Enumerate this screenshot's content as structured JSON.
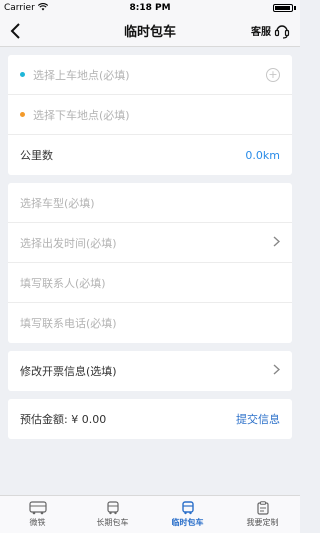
{
  "status": {
    "carrier": "Carrier",
    "time": "8:18 PM"
  },
  "nav": {
    "title": "临时包车",
    "service_label": "客服"
  },
  "trip": {
    "pickup_placeholder": "选择上车地点(必填)",
    "dropoff_placeholder": "选择下车地点(必填)",
    "distance_label": "公里数",
    "distance_value": "0.0km",
    "pickup_dot_color": "#1fb6d8",
    "dropoff_dot_color": "#f39a2b"
  },
  "details": {
    "vehicle_placeholder": "选择车型(必填)",
    "time_placeholder": "选择出发时间(必填)",
    "contact_name_placeholder": "填写联系人(必填)",
    "contact_phone_placeholder": "填写联系电话(必填)"
  },
  "invoice": {
    "label": "修改开票信息(选填)"
  },
  "estimate": {
    "label": "预估金额: ¥ 0.00",
    "submit_label": "提交信息"
  },
  "tabs": [
    {
      "label": "微铁",
      "icon": "bus-icon",
      "active": false
    },
    {
      "label": "长期包车",
      "icon": "bus-icon",
      "active": false
    },
    {
      "label": "临时包车",
      "icon": "bus-icon",
      "active": true
    },
    {
      "label": "我要定制",
      "icon": "clipboard-icon",
      "active": false
    }
  ]
}
